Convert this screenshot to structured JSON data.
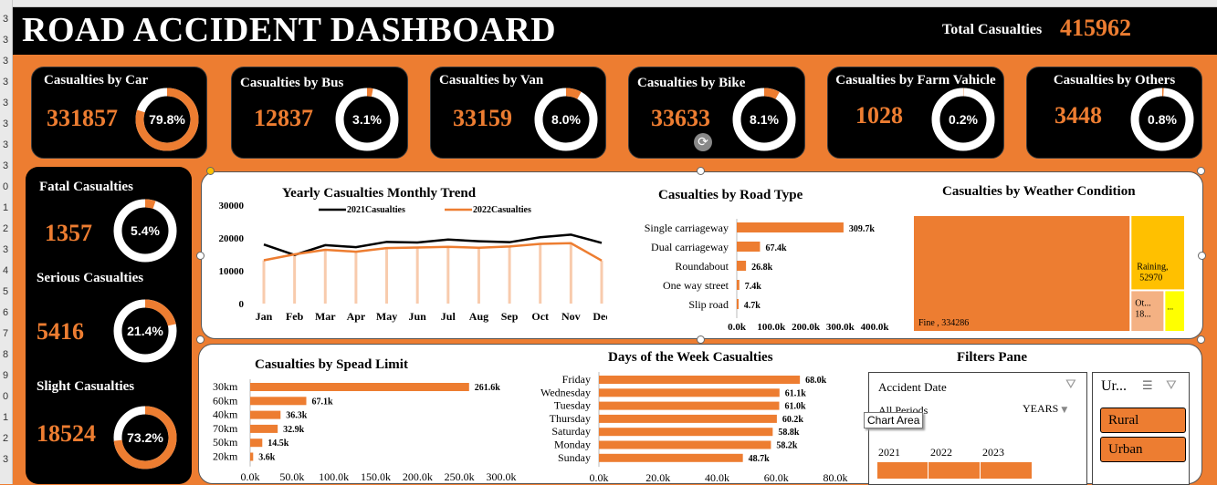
{
  "header": {
    "title": "ROAD ACCIDENT DASHBOARD",
    "total_label": "Total Casualties",
    "total_value": "415962"
  },
  "row_numbers": [
    "",
    "3",
    "3",
    "3",
    "3",
    "3",
    "3",
    "3",
    "3",
    "0",
    "1",
    "2",
    "3",
    "4",
    "5",
    "6",
    "7",
    "8",
    "9",
    "0",
    "1",
    "2",
    "3"
  ],
  "vehicle_cards": [
    {
      "label": "Casualties by Car",
      "value": "331857",
      "pct_label": "79.8%",
      "pct": 0.798
    },
    {
      "label": "Casualties by Bus",
      "value": "12837",
      "pct_label": "3.1%",
      "pct": 0.031
    },
    {
      "label": "Casualties by Van",
      "value": "33159",
      "pct_label": "8.0%",
      "pct": 0.08
    },
    {
      "label": "Casualties by Bike",
      "value": "33633",
      "pct_label": "8.1%",
      "pct": 0.081
    },
    {
      "label": "Casualties by Farm Vahicle",
      "value": "1028",
      "pct_label": "0.2%",
      "pct": 0.002
    },
    {
      "label": "Casualties by Others",
      "value": "3448",
      "pct_label": "0.8%",
      "pct": 0.008
    }
  ],
  "severity": [
    {
      "label": "Fatal Casualties",
      "value": "1357",
      "pct_label": "5.4%",
      "pct": 0.054
    },
    {
      "label": "Serious Casualties",
      "value": "5416",
      "pct_label": "21.4%",
      "pct": 0.214
    },
    {
      "label": "Slight Casualties",
      "value": "18524",
      "pct_label": "73.2%",
      "pct": 0.732
    }
  ],
  "colors": {
    "accent": "#ed7d31",
    "black": "#000000",
    "yellow": "#ffc000",
    "bright_yellow": "#ffff00",
    "peach": "#f4b183",
    "line2021": "#000000",
    "line2022": "#ed7d31"
  },
  "chart_data": [
    {
      "type": "line",
      "title": "Yearly Casualties Monthly Trend",
      "categories": [
        "Jan",
        "Feb",
        "Mar",
        "Apr",
        "May",
        "Jun",
        "Jul",
        "Aug",
        "Sep",
        "Oct",
        "Nov",
        "Dec"
      ],
      "series": [
        {
          "name": "2021Casualties",
          "values": [
            18000,
            14800,
            17800,
            17200,
            18800,
            18600,
            19500,
            19000,
            18700,
            20200,
            21000,
            18500
          ]
        },
        {
          "name": "2022Casualties",
          "values": [
            13200,
            15000,
            16400,
            15800,
            16900,
            17100,
            17300,
            17000,
            17400,
            18200,
            18400,
            13100
          ]
        }
      ],
      "yticks": [
        "30000",
        "20000",
        "10000",
        "0"
      ],
      "ylim": [
        0,
        30000
      ],
      "legend": "top"
    },
    {
      "type": "bar",
      "title": "Casualties by Road Type",
      "categories": [
        "Single carriageway",
        "Dual carriageway",
        "Roundabout",
        "One way street",
        "Slip road"
      ],
      "values": [
        309.7,
        67.4,
        26.8,
        7.4,
        4.7
      ],
      "labels": [
        "309.7k",
        "67.4k",
        "26.8k",
        "7.4k",
        "4.7k"
      ],
      "xticks": [
        "0.0k",
        "100.0k",
        "200.0k",
        "300.0k",
        "400.0k"
      ],
      "xlim": [
        0,
        400
      ]
    },
    {
      "type": "heatmap",
      "title": "Casualties by Weather Condition",
      "items": [
        {
          "label": "Fine , 334286",
          "value": 334286
        },
        {
          "label": "Raining, 52970",
          "value": 52970
        },
        {
          "label": "Ot... 18...",
          "value": 18000
        },
        {
          "label": "...",
          "value": 10000
        }
      ]
    },
    {
      "type": "bar",
      "title": "Casualties by Spead Limit",
      "categories": [
        "30km",
        "60km",
        "40km",
        "70km",
        "50km",
        "20km"
      ],
      "values": [
        261.6,
        67.1,
        36.3,
        32.9,
        14.5,
        3.6
      ],
      "labels": [
        "261.6k",
        "67.1k",
        "36.3k",
        "32.9k",
        "14.5k",
        "3.6k"
      ],
      "xticks": [
        "0.0k",
        "50.0k",
        "100.0k",
        "150.0k",
        "200.0k",
        "250.0k",
        "300.0k"
      ],
      "xlim": [
        0,
        300
      ]
    },
    {
      "type": "bar",
      "title": "Days of the Week Casualties",
      "categories": [
        "Friday",
        "Wednesday",
        "Tuesday",
        "Thursday",
        "Saturday",
        "Monday",
        "Sunday"
      ],
      "values": [
        68.0,
        61.1,
        61.0,
        60.2,
        58.8,
        58.2,
        48.7
      ],
      "labels": [
        "68.0k",
        "61.1k",
        "61.0k",
        "60.2k",
        "58.8k",
        "58.2k",
        "48.7k"
      ],
      "xticks": [
        "0.0k",
        "20.0k",
        "40.0k",
        "60.0k",
        "80.0k"
      ],
      "xlim": [
        0,
        80
      ]
    }
  ],
  "filters": {
    "title": "Filters Pane",
    "date_label": "Accident Date",
    "period": "All Periods",
    "years_label": "YEARS",
    "tooltip": "Chart Area",
    "years": [
      "2021",
      "2022",
      "2023"
    ],
    "urban_header": "Ur...",
    "urban_items": [
      "Rural",
      "Urban"
    ]
  }
}
